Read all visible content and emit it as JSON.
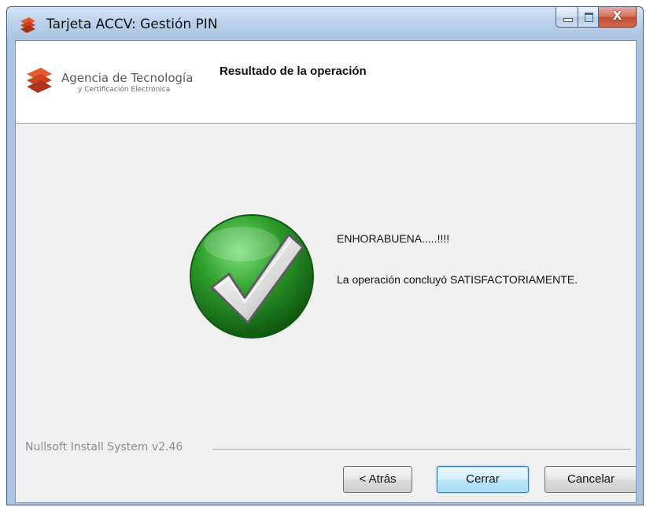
{
  "window": {
    "title": "Tarjeta ACCV: Gestión PIN",
    "controls": {
      "close_glyph": "X"
    }
  },
  "header": {
    "logo_line1": "Agencia de Tecnología",
    "logo_line2": "y Certificación Electrónica",
    "title": "Resultado de la operación"
  },
  "content": {
    "icon": "success-checkmark-icon",
    "message_1": "ENHORABUENA.....!!!!",
    "message_2": "La operación concluyó SATISFACTORIAMENTE."
  },
  "footer": {
    "branding": "Nullsoft Install System v2.46",
    "buttons": {
      "back": "< Atrás",
      "close": "Cerrar",
      "cancel": "Cancelar"
    }
  },
  "colors": {
    "accent_orange": "#e0532b",
    "success_green": "#2f9e2f",
    "title_bar": "#bcd2ea"
  }
}
